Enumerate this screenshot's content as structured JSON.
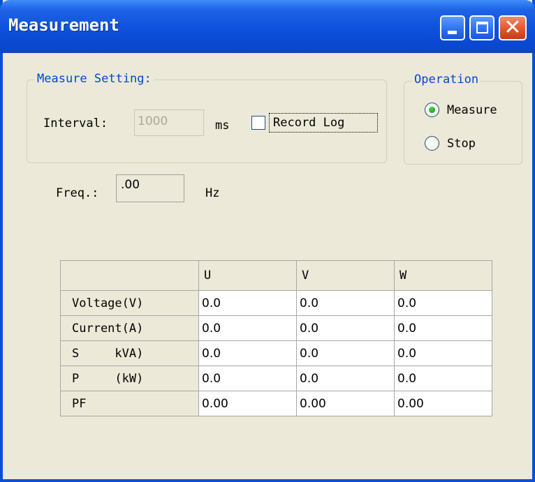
{
  "window": {
    "title": "Measurement",
    "buttons": {
      "minimize": "minimize-icon",
      "maximize": "maximize-icon",
      "close": "close-icon"
    }
  },
  "measure_setting": {
    "legend": "Measure Setting:",
    "interval_label": "Interval:",
    "interval_value": "1000",
    "interval_unit": "ms",
    "record_log_label": "Record Log",
    "record_log_checked": false
  },
  "operation": {
    "legend": "Operation",
    "options": [
      {
        "label": "Measure",
        "selected": true
      },
      {
        "label": "Stop",
        "selected": false
      }
    ]
  },
  "frequency": {
    "label": "Freq.:",
    "value": ".00",
    "unit": "Hz"
  },
  "table": {
    "columns": [
      "",
      "U",
      "V",
      "W"
    ],
    "rows": [
      {
        "label": "Voltage(V)",
        "values": [
          "0.0",
          "0.0",
          "0.0"
        ]
      },
      {
        "label": "Current(A)",
        "values": [
          "0.0",
          "0.0",
          "0.0"
        ]
      },
      {
        "label": "S     kVA)",
        "values": [
          "0.0",
          "0.0",
          "0.0"
        ]
      },
      {
        "label": "P     (kW)",
        "values": [
          "0.0",
          "0.0",
          "0.0"
        ]
      },
      {
        "label": "PF",
        "values": [
          "0.00",
          "0.00",
          "0.00"
        ]
      }
    ]
  },
  "colors": {
    "titlebar": "#0a48d0",
    "window_face": "#ece9d8",
    "group_legend": "#0046d5",
    "radio_selected": "#21a121"
  }
}
